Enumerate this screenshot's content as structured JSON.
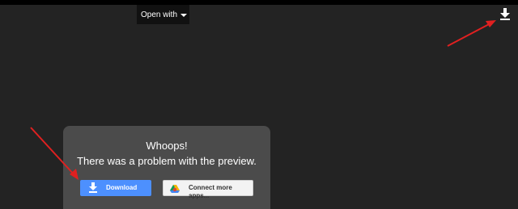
{
  "toolbar": {
    "open_with_label": "Open with"
  },
  "error_dialog": {
    "title": "Whoops!",
    "message": "There was a problem with the preview.",
    "download_label": "Download",
    "connect_label": "Connect more apps..."
  },
  "colors": {
    "background": "#232323",
    "dialog": "#4b4b4b",
    "primary_button": "#4d90fe",
    "annotation_arrow": "#e02020"
  },
  "icons": {
    "top_right": "download-icon",
    "download_button": "download-icon",
    "connect_button": "google-drive-icon"
  }
}
